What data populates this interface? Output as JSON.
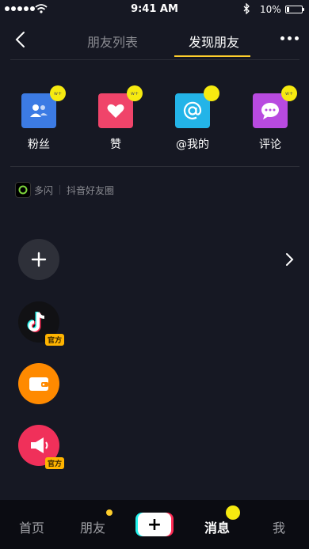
{
  "status_bar": {
    "time": "9:41 AM",
    "battery": "10%"
  },
  "header": {
    "tabs": [
      {
        "label": "朋友列表",
        "active": false
      },
      {
        "label": "发现朋友",
        "active": true
      }
    ],
    "accent_color": "#fece2c"
  },
  "categories": [
    {
      "label": "粉丝",
      "icon": "fans-icon",
      "color": "#3c7be4"
    },
    {
      "label": "赞",
      "icon": "heart-icon",
      "color": "#f0446a"
    },
    {
      "label": "@我的",
      "icon": "at-icon",
      "color": "#23b4e8"
    },
    {
      "label": "评论",
      "icon": "comment-icon",
      "color": "#b84ae0"
    }
  ],
  "sources": {
    "app_name": "多闪",
    "circle_label": "抖音好友圈"
  },
  "messages": [
    {
      "icon": "plus-icon"
    },
    {
      "icon": "douyin-logo-icon",
      "badge": "官方"
    },
    {
      "icon": "wallet-icon"
    },
    {
      "icon": "megaphone-icon",
      "badge": "官方"
    }
  ],
  "bottom_nav": {
    "home": "首页",
    "friends": "朋友",
    "messages": "消息",
    "me": "我"
  }
}
